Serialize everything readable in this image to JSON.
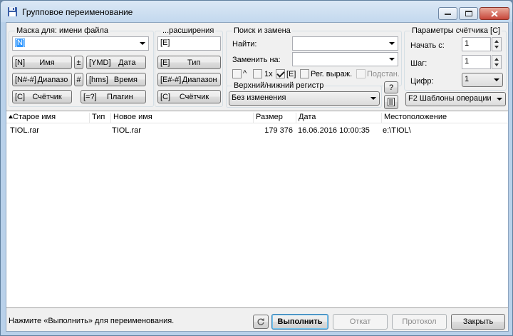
{
  "window": {
    "title": "Групповое переименование",
    "icon": "floppy-disk-icon"
  },
  "mask": {
    "group_label": "Маска для: имени файла",
    "name_mask_value": "[N]",
    "ext_group_label": "...расширения",
    "ext_mask_value": "[E]",
    "buttons": {
      "name": {
        "key": "[N]",
        "label": "Имя"
      },
      "plus": {
        "label": "±"
      },
      "date": {
        "key": "[YMD]",
        "label": "Дата"
      },
      "range": {
        "key": "[N#-#]",
        "label": "Диапазо"
      },
      "hash": {
        "label": "#"
      },
      "time": {
        "key": "[hms]",
        "label": "Время"
      },
      "counter": {
        "key": "[C]",
        "label": "Счётчик"
      },
      "plugin": {
        "key": "[=?]",
        "label": "Плагин"
      },
      "ext_type": {
        "key": "[E]",
        "label": "Тип"
      },
      "ext_range": {
        "key": "[E#-#]",
        "label": "Диапазон"
      },
      "ext_counter": {
        "key": "[C]",
        "label": "Счётчик"
      }
    }
  },
  "search": {
    "group_label": "Поиск и замена",
    "find_label": "Найти:",
    "find_value": "",
    "replace_label": "Заменить на:",
    "replace_value": "",
    "opt_caret": "^",
    "opt_1x": "1x",
    "opt_e": "[E]",
    "opt_regex": "Рег. выраж.",
    "opt_subst": "Подстан.",
    "checked": {
      "caret": false,
      "1x": false,
      "e": true,
      "regex": false,
      "subst": false
    }
  },
  "case": {
    "group_label": "Верхний/нижний регистр",
    "value": "Без изменения",
    "help_label": "?"
  },
  "counter": {
    "group_label": "Параметры счётчика [C]",
    "start_label": "Начать с:",
    "start_value": "1",
    "step_label": "Шаг:",
    "step_value": "1",
    "digits_label": "Цифр:",
    "digits_value": "1"
  },
  "templates_button": "F2 Шаблоны операции",
  "list": {
    "columns": [
      "Старое имя",
      "Тип",
      "Новое имя",
      "Размер",
      "Дата",
      "Местоположение"
    ],
    "rows": [
      {
        "old": "TIOL.rar",
        "type": "",
        "new": "TIOL.rar",
        "size": "179 376",
        "date": "16.06.2016 10:00:35",
        "path": "e:\\TIOL\\"
      }
    ]
  },
  "footer": {
    "status": "Нажмите «Выполнить» для переименования.",
    "run": "Выполнить",
    "undo": "Откат",
    "log": "Протокол",
    "close": "Закрыть"
  },
  "colors": {
    "selection": "#3399ff",
    "titlebar": "#c3d8ee"
  }
}
